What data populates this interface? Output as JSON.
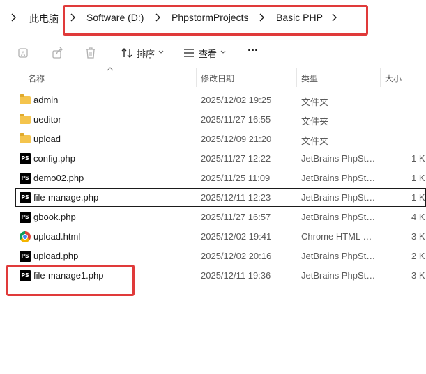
{
  "breadcrumb": {
    "items": [
      "此电脑",
      "Software (D:)",
      "PhpstormProjects",
      "Basic PHP"
    ]
  },
  "toolbar": {
    "sort_label": "排序",
    "view_label": "查看",
    "more_label": "···"
  },
  "columns": {
    "name": "名称",
    "modified": "修改日期",
    "type": "类型",
    "size": "大小"
  },
  "files": [
    {
      "name": "admin",
      "modified": "2025/12/02 19:25",
      "type": "文件夹",
      "size": "",
      "icon": "folder-icon"
    },
    {
      "name": "ueditor",
      "modified": "2025/11/27 16:55",
      "type": "文件夹",
      "size": "",
      "icon": "folder-icon"
    },
    {
      "name": "upload",
      "modified": "2025/12/09 21:20",
      "type": "文件夹",
      "size": "",
      "icon": "folder-icon"
    },
    {
      "name": "config.php",
      "modified": "2025/11/27 12:22",
      "type": "JetBrains PhpSto...",
      "size": "1 K",
      "icon": "phpstorm-file-icon"
    },
    {
      "name": "demo02.php",
      "modified": "2025/11/25 11:09",
      "type": "JetBrains PhpSto...",
      "size": "1 K",
      "icon": "phpstorm-file-icon"
    },
    {
      "name": "file-manage.php",
      "modified": "2025/12/11 12:23",
      "type": "JetBrains PhpSto...",
      "size": "1 K",
      "icon": "phpstorm-file-icon"
    },
    {
      "name": "gbook.php",
      "modified": "2025/11/27 16:57",
      "type": "JetBrains PhpSto...",
      "size": "4 K",
      "icon": "phpstorm-file-icon"
    },
    {
      "name": "upload.html",
      "modified": "2025/12/02 19:41",
      "type": "Chrome HTML D...",
      "size": "3 K",
      "icon": "chrome-html-icon"
    },
    {
      "name": "upload.php",
      "modified": "2025/12/02 20:16",
      "type": "JetBrains PhpSto...",
      "size": "2 K",
      "icon": "phpstorm-file-icon"
    },
    {
      "name": "file-manage1.php",
      "modified": "2025/12/11 19:36",
      "type": "JetBrains PhpSto...",
      "size": "3 K",
      "icon": "phpstorm-file-icon"
    }
  ],
  "icon_text": {
    "phpstorm": "PS"
  },
  "colors": {
    "highlight": "#e03a3a",
    "folder": "#f4c44d"
  }
}
